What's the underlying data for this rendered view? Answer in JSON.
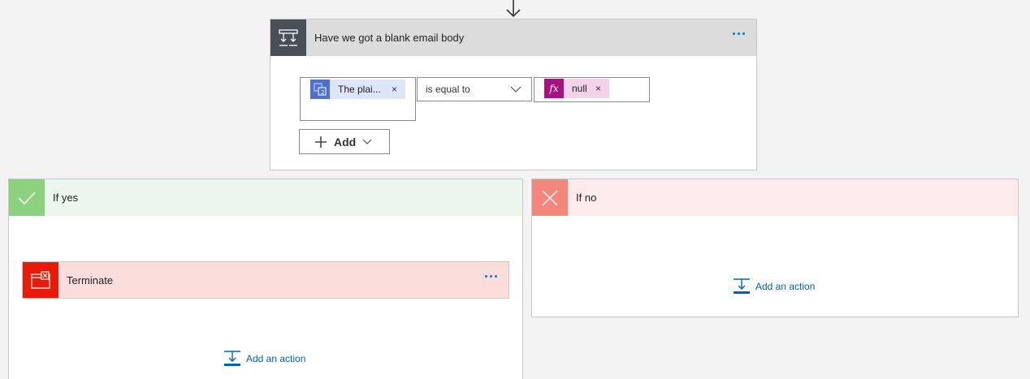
{
  "condition": {
    "title": "Have we got a blank email body",
    "left_token": {
      "label": "The plai..."
    },
    "operator": "is equal to",
    "right_token": {
      "icon": "fx",
      "label": "null"
    },
    "add_label": "Add",
    "remove_symbol": "×"
  },
  "branches": {
    "yes": {
      "title": "If yes",
      "action": {
        "title": "Terminate"
      },
      "add_action_label": "Add an action"
    },
    "no": {
      "title": "If no",
      "add_action_label": "Add an action"
    }
  },
  "colors": {
    "accent": "#0078d4",
    "condition_icon_bg": "#484f58",
    "yes_icon_bg": "#8cd17e",
    "no_icon_bg": "#f4867c",
    "terminate_icon_bg": "#e81b0a",
    "expression_token_bg": "#a5127f",
    "dynamic_token_bg": "#5171c9"
  },
  "icons": {
    "flow_arrow": "arrow-down-icon",
    "condition": "condition-icon",
    "dynamic_content": "dynamic-content-icon",
    "expression": "expression-fx-icon",
    "yes": "checkmark-icon",
    "no": "cross-icon",
    "terminate": "terminate-icon",
    "add_action": "add-action-icon"
  }
}
